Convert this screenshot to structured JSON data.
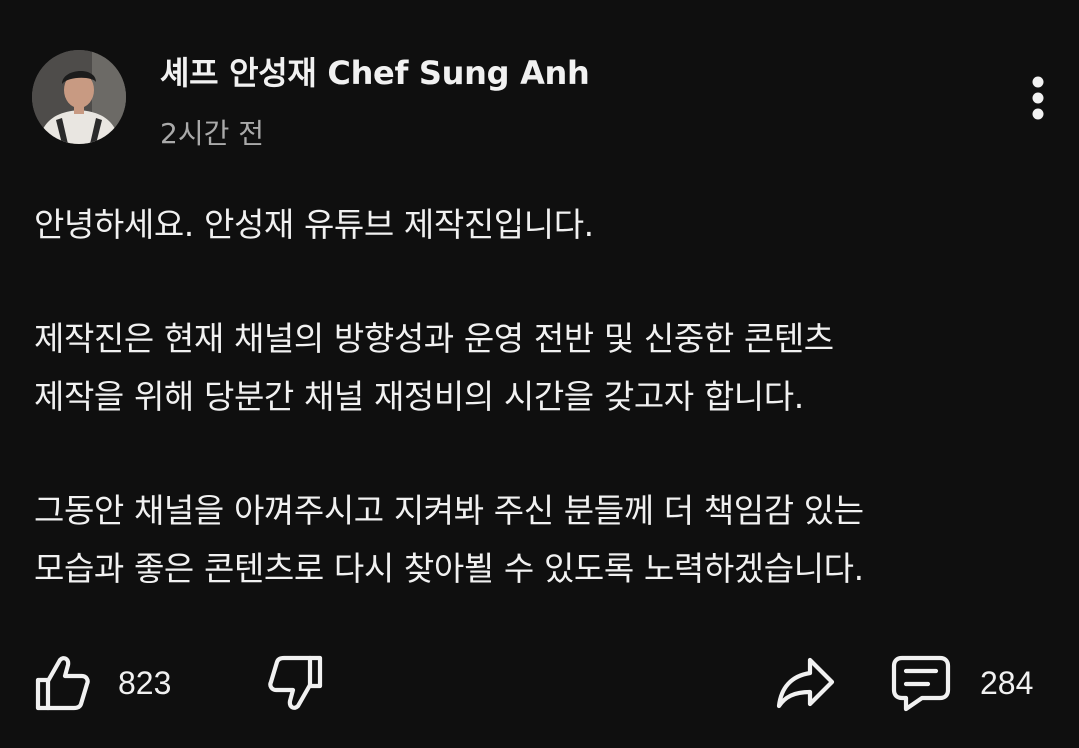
{
  "post": {
    "channel_name": "셰프 안성재 Chef Sung Anh",
    "timestamp": "2시간 전",
    "paragraphs": [
      [
        "안녕하세요. 안성재 유튜브 제작진입니다."
      ],
      [
        "제작진은 현재 채널의 방향성과 운영 전반 및 신중한 콘텐츠",
        "제작을 위해 당분간 채널 재정비의 시간을 갖고자 합니다."
      ],
      [
        "그동안 채널을 아껴주시고 지켜봐 주신 분들께 더 책임감 있는",
        "모습과 좋은 콘텐츠로 다시 찾아뵐 수 있도록 노력하겠습니다."
      ]
    ],
    "actions": {
      "like_count": "823",
      "comment_count": "284"
    },
    "icons": {
      "avatar": "avatar",
      "more": "more-vertical-icon",
      "like": "thumbs-up-icon",
      "dislike": "thumbs-down-icon",
      "share": "share-icon",
      "comment": "comment-icon"
    },
    "colors": {
      "background": "#0f0f0f",
      "text": "#f1f1f1",
      "secondary_text": "#aaaaaa"
    }
  }
}
